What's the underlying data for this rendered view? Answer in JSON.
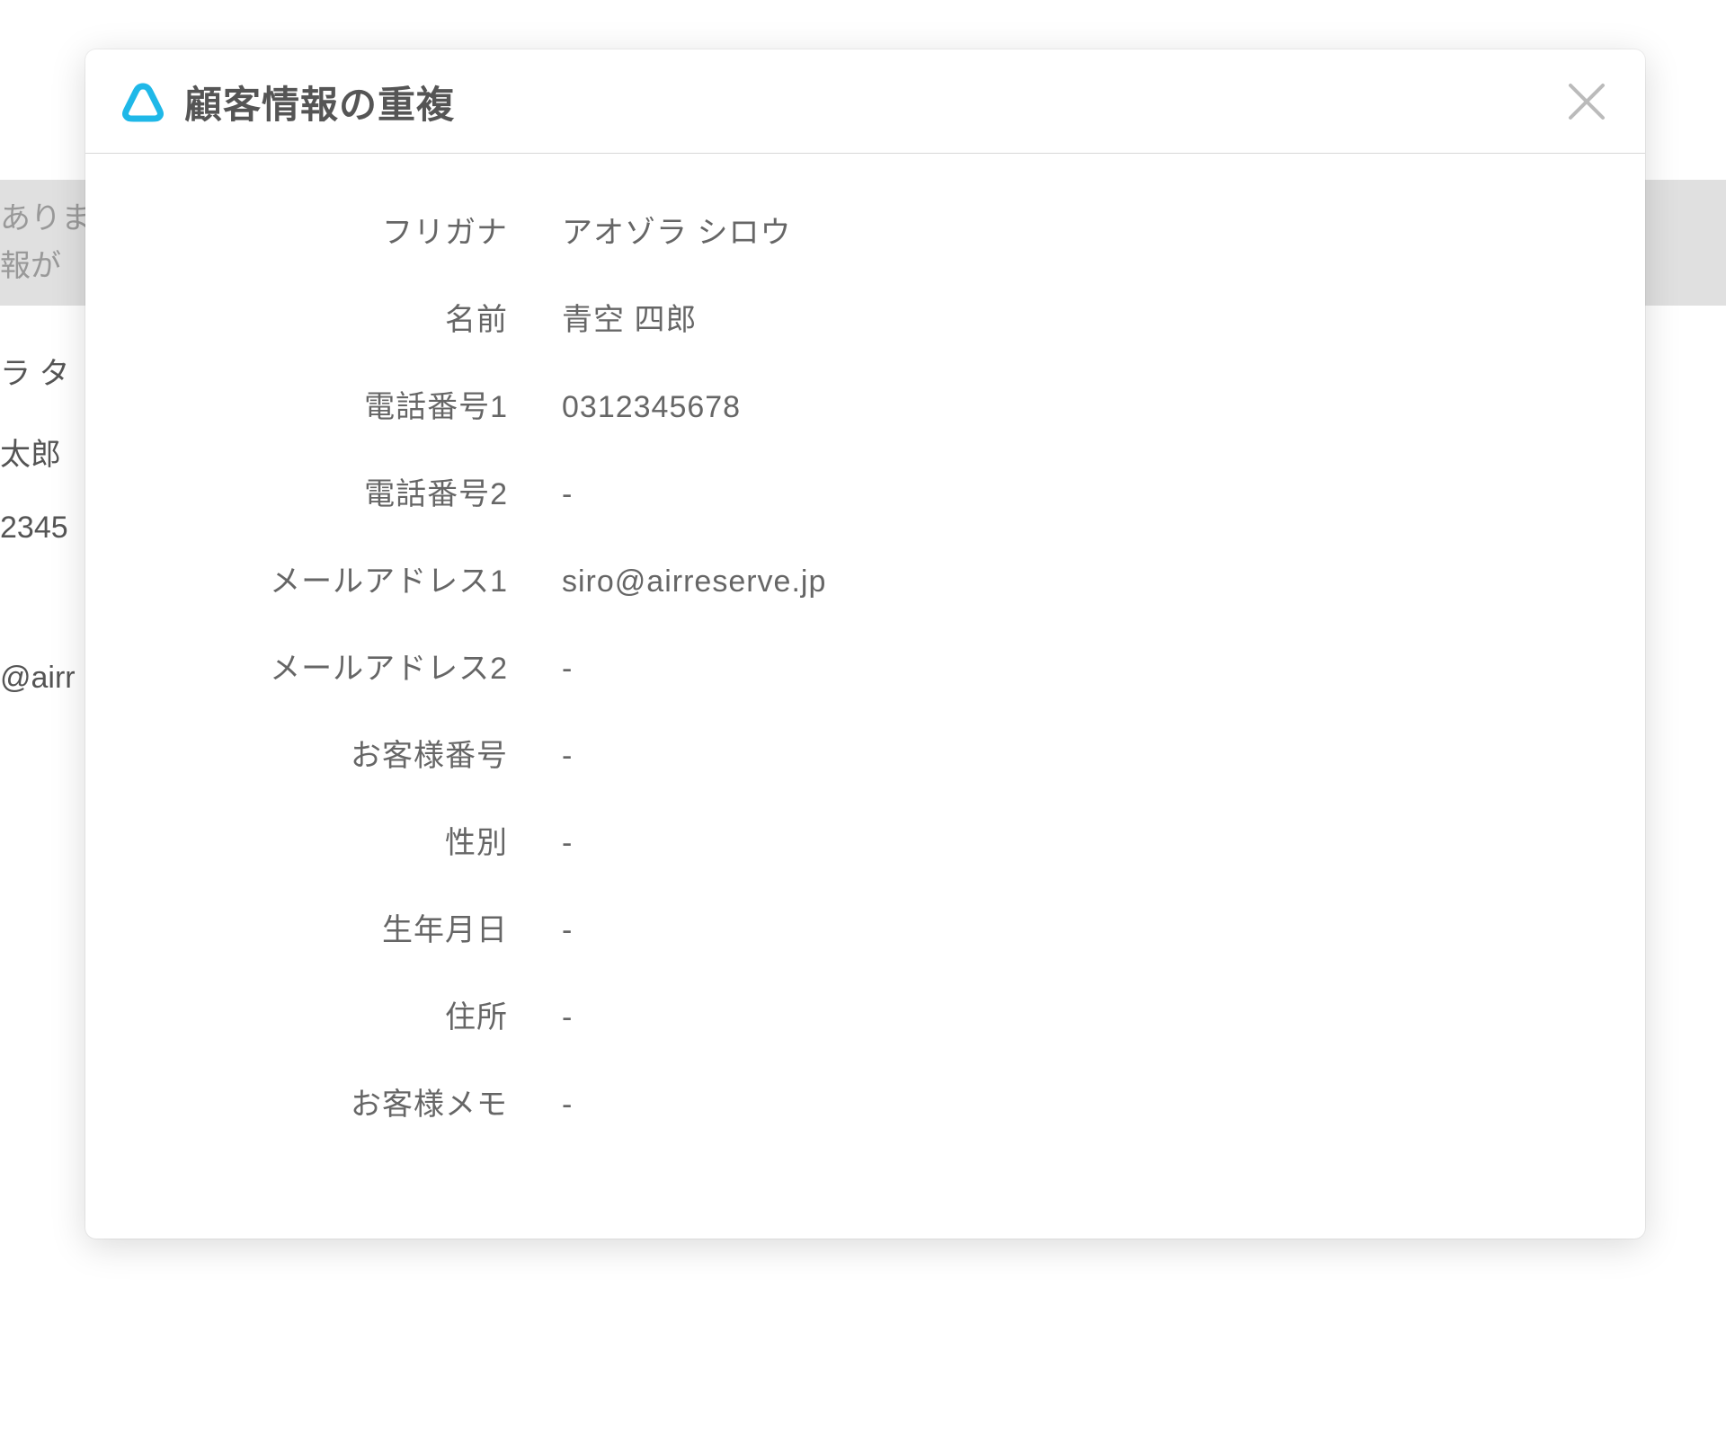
{
  "background": {
    "text1": "ありま",
    "text2": "報が",
    "text3": "ラ タ",
    "text4": "太郎",
    "text5": "2345",
    "text6": "@airr"
  },
  "modal": {
    "title": "顧客情報の重複",
    "fields": [
      {
        "label": "フリガナ",
        "value": "アオゾラ シロウ"
      },
      {
        "label": "名前",
        "value": "青空 四郎"
      },
      {
        "label": "電話番号1",
        "value": "0312345678"
      },
      {
        "label": "電話番号2",
        "value": "-"
      },
      {
        "label": "メールアドレス1",
        "value": "siro@airreserve.jp"
      },
      {
        "label": "メールアドレス2",
        "value": "-"
      },
      {
        "label": "お客様番号",
        "value": "-"
      },
      {
        "label": "性別",
        "value": "-"
      },
      {
        "label": "生年月日",
        "value": "-"
      },
      {
        "label": "住所",
        "value": "-"
      },
      {
        "label": "お客様メモ",
        "value": "-"
      }
    ]
  }
}
